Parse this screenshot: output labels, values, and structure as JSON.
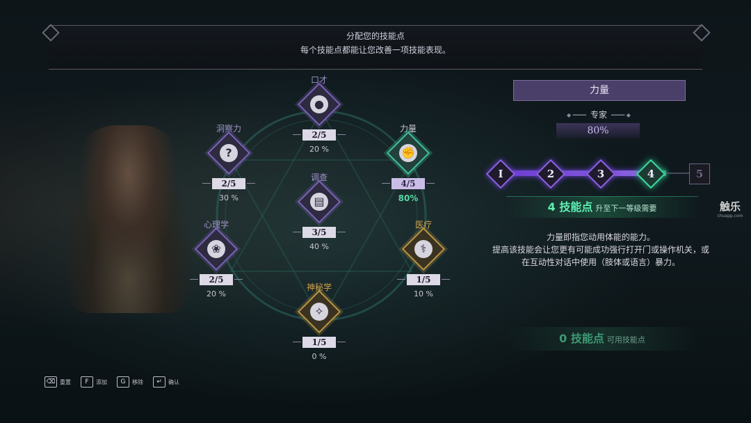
{
  "banner": {
    "title": "分配您的技能点",
    "subtitle": "每个技能点都能让您改善一项技能表现。"
  },
  "skills": [
    {
      "name": "口才",
      "value": "2/5",
      "percent": "20 %",
      "icon": "coins-icon"
    },
    {
      "name": "洞察力",
      "value": "2/5",
      "percent": "30 %",
      "icon": "question-mark-icon"
    },
    {
      "name": "力量",
      "value": "4/5",
      "percent": "80%",
      "icon": "fist-icon"
    },
    {
      "name": "调查",
      "value": "3/5",
      "percent": "40 %",
      "icon": "documents-icon"
    },
    {
      "name": "心理学",
      "value": "2/5",
      "percent": "20 %",
      "icon": "brain-icon"
    },
    {
      "name": "医疗",
      "value": "1/5",
      "percent": "10 %",
      "icon": "caduceus-icon"
    },
    {
      "name": "神秘学",
      "value": "1/5",
      "percent": "0 %",
      "icon": "occult-sigil-icon"
    }
  ],
  "detail": {
    "skill_name": "力量",
    "rank_title": "专家",
    "rank_percent": "80%",
    "tiers": [
      "I",
      "2",
      "3",
      "4",
      "5"
    ],
    "current_tier": 4,
    "next_cost_number": "4 技能点",
    "next_cost_label": "升至下一等级需要",
    "description": [
      "力量即指您动用体能的能力。",
      "提高该技能会让您更有可能成功强行打开门或操作机关，或",
      "在互动性对话中使用（肢体或语言）暴力。"
    ],
    "available_number": "0 技能点",
    "available_label": "可用技能点"
  },
  "controls": [
    {
      "key": "⌫",
      "label": "重置"
    },
    {
      "key": "F",
      "label": "添加"
    },
    {
      "key": "G",
      "label": "移除"
    },
    {
      "key": "↵",
      "label": "确认"
    }
  ],
  "watermark": {
    "title": "触乐",
    "url": "chuapp.com"
  },
  "colors": {
    "accent_purple": "#8a62e0",
    "accent_teal": "#3fd8a0",
    "gold": "#d4a24a"
  }
}
